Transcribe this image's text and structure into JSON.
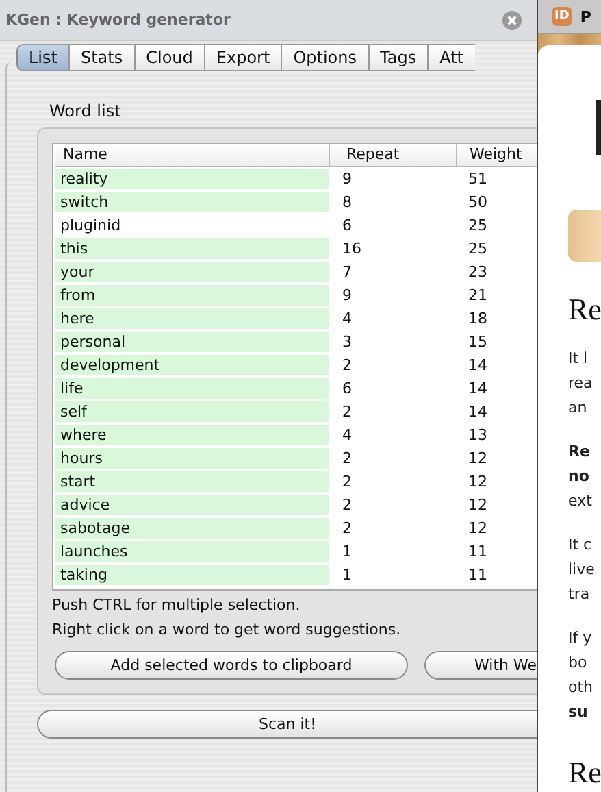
{
  "window": {
    "title": "KGen : Keyword generator"
  },
  "tabs": [
    {
      "label": "List",
      "selected": true
    },
    {
      "label": "Stats",
      "selected": false
    },
    {
      "label": "Cloud",
      "selected": false
    },
    {
      "label": "Export",
      "selected": false
    },
    {
      "label": "Options",
      "selected": false
    },
    {
      "label": "Tags",
      "selected": false
    },
    {
      "label": "Att",
      "selected": false
    }
  ],
  "word_list": {
    "title": "Word list",
    "columns": [
      "Name",
      "Repeat",
      "Weight"
    ],
    "rows": [
      {
        "name": "reality",
        "repeat": "9",
        "weight": "51",
        "selected": true
      },
      {
        "name": "switch",
        "repeat": "8",
        "weight": "50",
        "selected": true
      },
      {
        "name": "pluginid",
        "repeat": "6",
        "weight": "25",
        "selected": false
      },
      {
        "name": "this",
        "repeat": "16",
        "weight": "25",
        "selected": true
      },
      {
        "name": "your",
        "repeat": "7",
        "weight": "23",
        "selected": true
      },
      {
        "name": "from",
        "repeat": "9",
        "weight": "21",
        "selected": true
      },
      {
        "name": "here",
        "repeat": "4",
        "weight": "18",
        "selected": true
      },
      {
        "name": "personal",
        "repeat": "3",
        "weight": "15",
        "selected": true
      },
      {
        "name": "development",
        "repeat": "2",
        "weight": "14",
        "selected": true
      },
      {
        "name": "life",
        "repeat": "6",
        "weight": "14",
        "selected": true
      },
      {
        "name": "self",
        "repeat": "2",
        "weight": "14",
        "selected": true
      },
      {
        "name": "where",
        "repeat": "4",
        "weight": "13",
        "selected": true
      },
      {
        "name": "hours",
        "repeat": "2",
        "weight": "12",
        "selected": true
      },
      {
        "name": "start",
        "repeat": "2",
        "weight": "12",
        "selected": true
      },
      {
        "name": "advice",
        "repeat": "2",
        "weight": "12",
        "selected": true
      },
      {
        "name": "sabotage",
        "repeat": "2",
        "weight": "12",
        "selected": true
      },
      {
        "name": "launches",
        "repeat": "1",
        "weight": "11",
        "selected": true
      },
      {
        "name": "taking",
        "repeat": "1",
        "weight": "11",
        "selected": true
      }
    ],
    "hints": [
      "Push CTRL for multiple selection.",
      "Right click on a word to get word suggestions."
    ],
    "buttons": [
      "Add selected words to clipboard",
      "With We"
    ]
  },
  "scan_button": "Scan it!",
  "browser": {
    "tab_badge": "ID",
    "tab_label": "P",
    "blocks": [
      {
        "kind": "heading",
        "lines": [
          {
            "text": "Re",
            "bold": false
          }
        ]
      },
      {
        "kind": "para",
        "lines": [
          {
            "text": "It l",
            "bold": false
          },
          {
            "text": "rea",
            "bold": false
          },
          {
            "text": "an",
            "bold": false
          }
        ]
      },
      {
        "kind": "para",
        "lines": [
          {
            "text": "Re",
            "bold": true
          },
          {
            "text": "no",
            "bold": true
          },
          {
            "text": "ext",
            "bold": false
          }
        ]
      },
      {
        "kind": "para",
        "lines": [
          {
            "text": "It c",
            "bold": false
          },
          {
            "text": "live",
            "bold": false
          },
          {
            "text": "tra",
            "bold": false
          }
        ]
      },
      {
        "kind": "para",
        "lines": [
          {
            "text": "If y",
            "bold": false
          },
          {
            "text": "bo",
            "bold": false
          },
          {
            "text": "oth",
            "bold": false
          },
          {
            "text": "su",
            "bold": true
          }
        ]
      },
      {
        "kind": "heading",
        "lines": [
          {
            "text": "Re",
            "bold": false
          }
        ]
      }
    ]
  }
}
